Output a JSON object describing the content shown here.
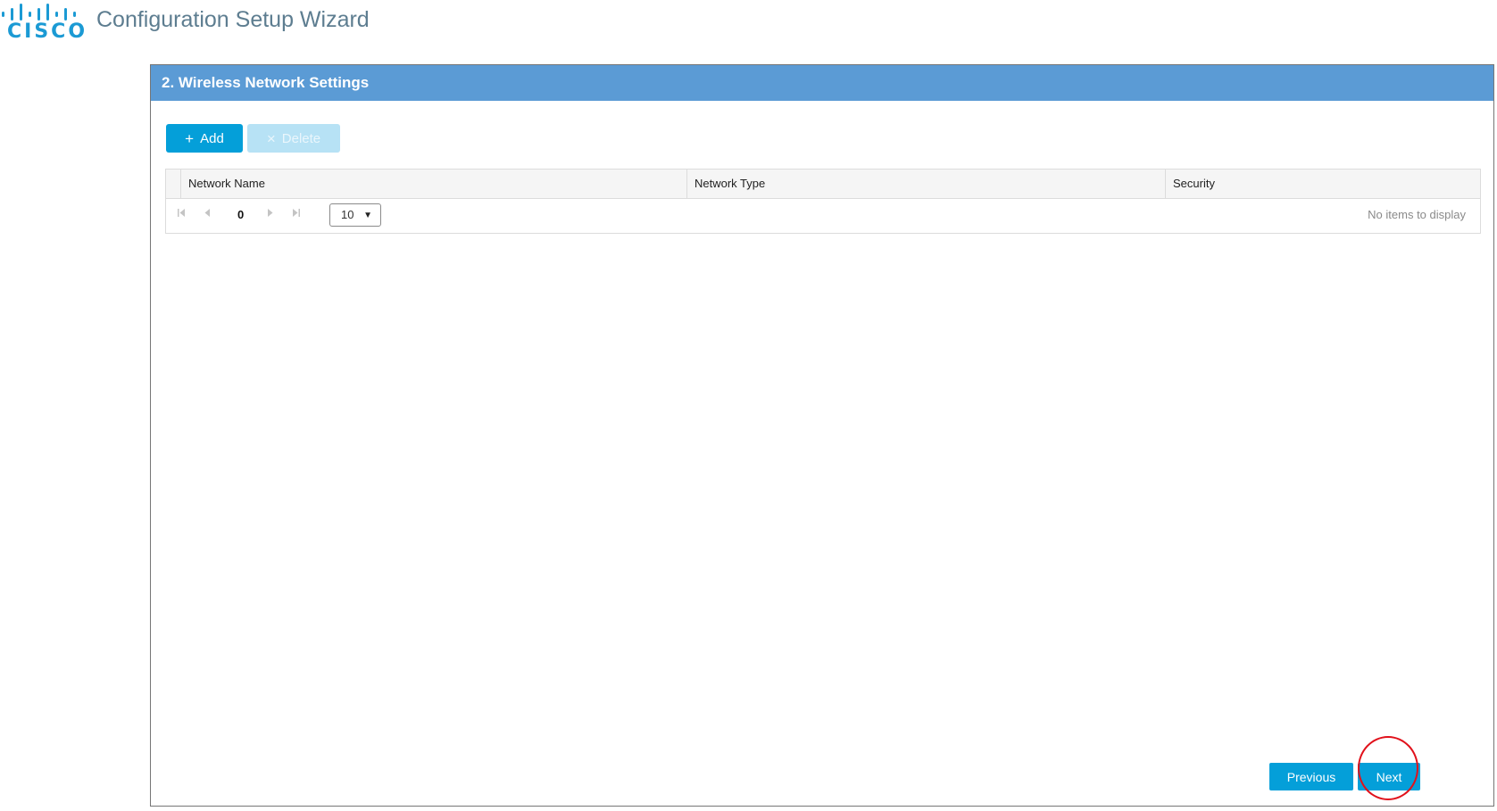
{
  "header": {
    "logo_text": "CISCO",
    "title": "Configuration Setup Wizard",
    "logo_color": "#1b9ad4"
  },
  "panel": {
    "title": "2. Wireless Network Settings",
    "header_color": "#5b9bd5"
  },
  "toolbar": {
    "add_label": "Add",
    "add_icon": "plus-icon",
    "delete_label": "Delete",
    "delete_icon": "x-icon",
    "delete_enabled": false
  },
  "table": {
    "columns": [
      "Network Name",
      "Network Type",
      "Security"
    ],
    "rows": []
  },
  "pager": {
    "current_page": "0",
    "page_size": "10",
    "empty_message": "No items to display",
    "icons": [
      "first-page-icon",
      "previous-page-icon",
      "next-page-icon",
      "last-page-icon"
    ]
  },
  "footer": {
    "previous_label": "Previous",
    "next_label": "Next"
  },
  "colors": {
    "primary_button": "#049fd9",
    "disabled_button": "#b7e2f5",
    "annotation": "#e1111b"
  }
}
